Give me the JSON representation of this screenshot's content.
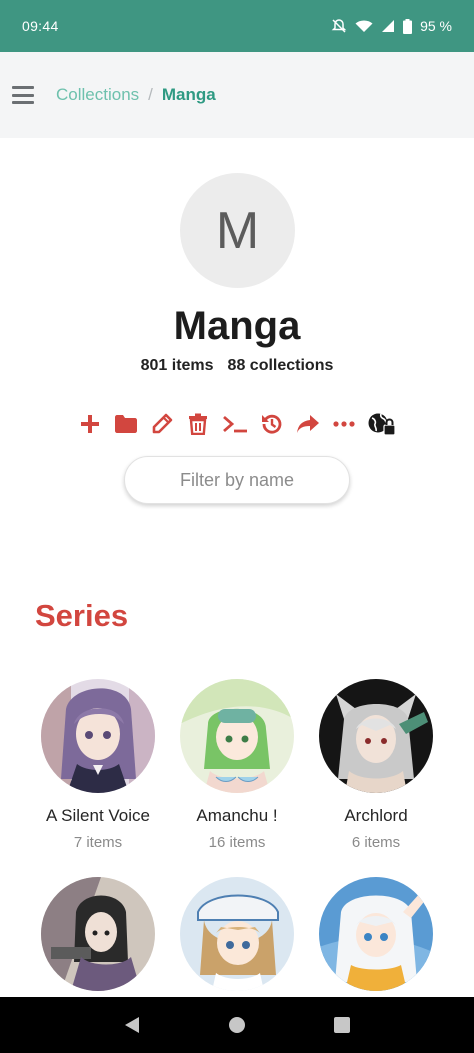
{
  "status_bar": {
    "time": "09:44",
    "battery": "95 %",
    "icons": [
      "bell-off-icon",
      "wifi-icon",
      "signal-icon",
      "battery-icon"
    ]
  },
  "breadcrumb": {
    "parent": "Collections",
    "separator": "/",
    "current": "Manga"
  },
  "collection": {
    "avatar_letter": "M",
    "title": "Manga",
    "items": "801 items",
    "collections": "88 collections"
  },
  "toolbar": {
    "accent": "#d2463f",
    "actions": [
      "add-icon",
      "folder-icon",
      "edit-icon",
      "delete-icon",
      "terminal-icon",
      "history-icon",
      "share-icon",
      "more-icon",
      "public-lock-icon"
    ]
  },
  "filter": {
    "placeholder": "Filter by name",
    "value": ""
  },
  "series": {
    "heading": "Series",
    "cards": [
      {
        "name": "A Silent Voice",
        "count": "7 items"
      },
      {
        "name": "Amanchu !",
        "count": "16 items"
      },
      {
        "name": "Archlord",
        "count": "6 items"
      },
      {
        "name": "",
        "count": ""
      },
      {
        "name": "",
        "count": ""
      },
      {
        "name": "",
        "count": ""
      }
    ]
  },
  "colors": {
    "status_bar": "#3f9682",
    "breadcrumb_link": "#6ec1ad",
    "breadcrumb_current": "#2f9a83",
    "section_title": "#d2463f"
  }
}
